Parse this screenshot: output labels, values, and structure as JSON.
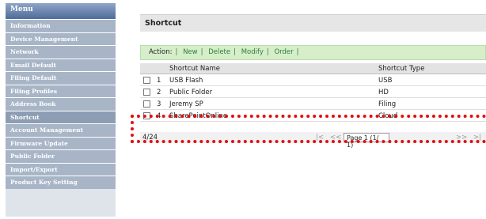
{
  "sidebar": {
    "header": "Menu",
    "items": [
      {
        "label": "Information"
      },
      {
        "label": "Device Management"
      },
      {
        "label": "Network"
      },
      {
        "label": "Email Default"
      },
      {
        "label": "Filing Default"
      },
      {
        "label": "Filing Profiles"
      },
      {
        "label": "Address Book"
      },
      {
        "label": "Shortcut",
        "active": true
      },
      {
        "label": "Account Management"
      },
      {
        "label": "Firmware Update"
      },
      {
        "label": "Public Folder"
      },
      {
        "label": "Import/Export"
      },
      {
        "label": "Product Key Setting"
      }
    ]
  },
  "panel": {
    "title": "Shortcut",
    "action_label": "Action:",
    "actions": [
      "New",
      "Delete",
      "Modify",
      "Order"
    ]
  },
  "table": {
    "columns": [
      "Shortcut Name",
      "Shortcut Type"
    ],
    "rows": [
      {
        "num": "1",
        "name": "USB Flash",
        "type": "USB"
      },
      {
        "num": "2",
        "name": "Public Folder",
        "type": "HD"
      },
      {
        "num": "3",
        "name": "Jeremy SP",
        "type": "Filing"
      },
      {
        "num": "4",
        "name": "SharePointOnline",
        "type": "Cloud"
      }
    ]
  },
  "pager": {
    "count": "4/24",
    "first": "|<",
    "prev": "<<",
    "page": "Page 1 (1/ 1)",
    "next": ">>",
    "last": ">|"
  },
  "colors": {
    "highlight": "#e01010",
    "action_bar": "#d6eec9",
    "sidebar_item": "#a8b5c7"
  }
}
